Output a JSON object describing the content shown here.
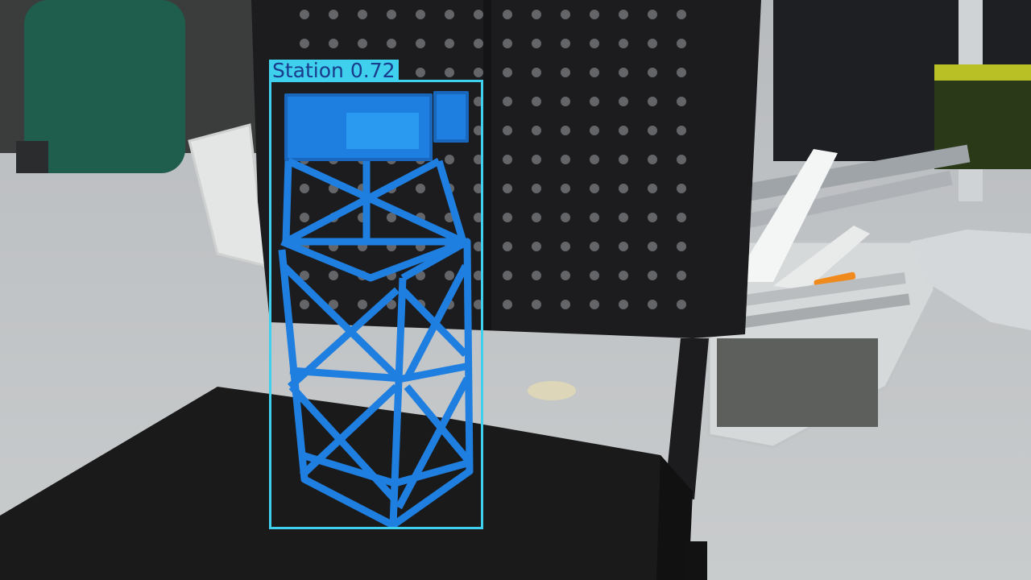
{
  "detection": {
    "label": "Station",
    "confidence": "0.72",
    "box_color": "#3fd0ee",
    "label_text_color": "#1a3c8c"
  },
  "scene": {
    "object_color": "#1f7fe0",
    "chair_color": "#1c1c1e",
    "floor_color": "#bfc2c4"
  }
}
